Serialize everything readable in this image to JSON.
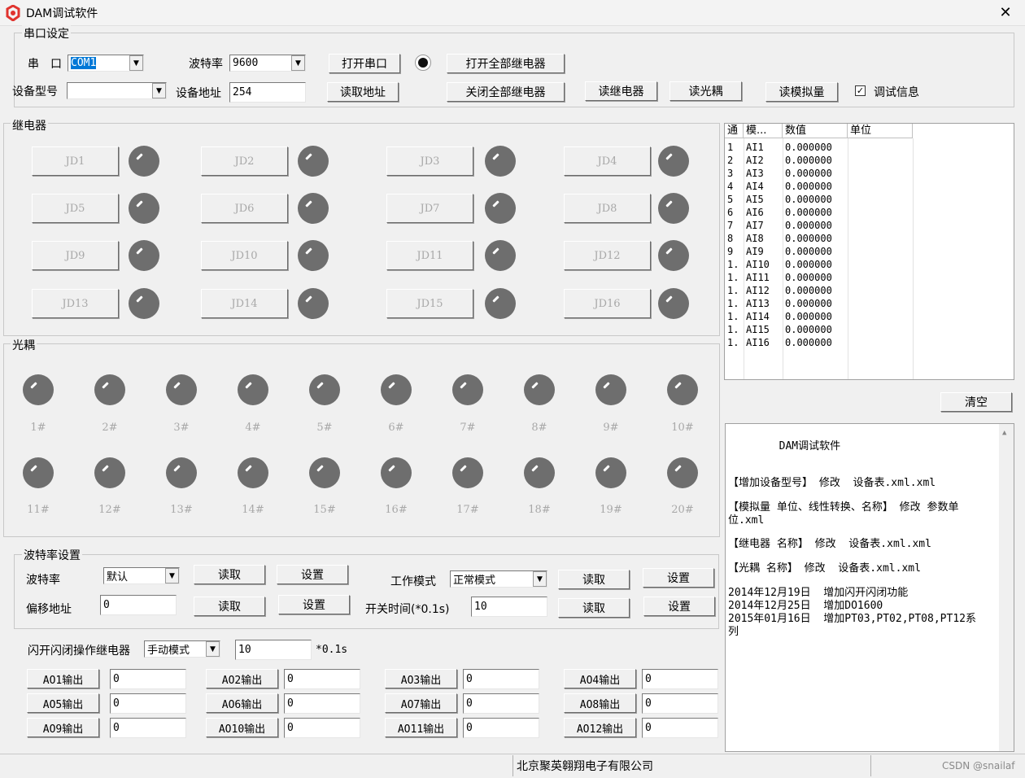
{
  "window": {
    "title": "DAM调试软件",
    "close_glyph": "✕"
  },
  "serial": {
    "group_label": "串口设定",
    "port_label": "串　口",
    "port_value": "COM1",
    "baud_label": "波特率",
    "baud_value": "9600",
    "open_port": "打开串口",
    "open_all_relays": "打开全部继电器",
    "device_model_label": "设备型号",
    "device_model_value": "",
    "device_addr_label": "设备地址",
    "device_addr_value": "254",
    "read_addr": "读取地址",
    "close_all_relays": "关闭全部继电器",
    "read_relay": "读继电器",
    "read_optocoupler": "读光耦",
    "read_analog": "读模拟量",
    "debug_info_label": "调试信息",
    "debug_info_checked": true
  },
  "relays": {
    "group_label": "继电器",
    "items": [
      "JD1",
      "JD2",
      "JD3",
      "JD4",
      "JD5",
      "JD6",
      "JD7",
      "JD8",
      "JD9",
      "JD10",
      "JD11",
      "JD12",
      "JD13",
      "JD14",
      "JD15",
      "JD16"
    ]
  },
  "optocouplers": {
    "group_label": "光耦",
    "items": [
      "1#",
      "2#",
      "3#",
      "4#",
      "5#",
      "6#",
      "7#",
      "8#",
      "9#",
      "10#",
      "11#",
      "12#",
      "13#",
      "14#",
      "15#",
      "16#",
      "17#",
      "18#",
      "19#",
      "20#"
    ]
  },
  "analog_table": {
    "headers": [
      "通",
      "模...",
      "数值",
      "单位"
    ],
    "rows": [
      [
        "1",
        "AI1",
        "0.000000",
        ""
      ],
      [
        "2",
        "AI2",
        "0.000000",
        ""
      ],
      [
        "3",
        "AI3",
        "0.000000",
        ""
      ],
      [
        "4",
        "AI4",
        "0.000000",
        ""
      ],
      [
        "5",
        "AI5",
        "0.000000",
        ""
      ],
      [
        "6",
        "AI6",
        "0.000000",
        ""
      ],
      [
        "7",
        "AI7",
        "0.000000",
        ""
      ],
      [
        "8",
        "AI8",
        "0.000000",
        ""
      ],
      [
        "9",
        "AI9",
        "0.000000",
        ""
      ],
      [
        "1.",
        "AI10",
        "0.000000",
        ""
      ],
      [
        "1.",
        "AI11",
        "0.000000",
        ""
      ],
      [
        "1.",
        "AI12",
        "0.000000",
        ""
      ],
      [
        "1.",
        "AI13",
        "0.000000",
        ""
      ],
      [
        "1.",
        "AI14",
        "0.000000",
        ""
      ],
      [
        "1.",
        "AI15",
        "0.000000",
        ""
      ],
      [
        "1.",
        "AI16",
        "0.000000",
        ""
      ]
    ]
  },
  "clear_button": "清空",
  "info_memo": {
    "lines": [
      "        DAM调试软件",
      "【增加设备型号】 修改  设备表.xml.xml",
      "【模拟量 单位、线性转换、名称】 修改 参数单",
      "位.xml",
      "【继电器 名称】 修改  设备表.xml.xml",
      "【光耦 名称】 修改  设备表.xml.xml",
      "2014年12月19日  增加闪开闪闭功能",
      "2014年12月25日  增加DO1600",
      "2015年01月16日  增加PT03,PT02,PT08,PT12系",
      "列"
    ]
  },
  "baud_settings": {
    "group_label": "波特率设置",
    "baud_label": "波特率",
    "baud_value": "默认",
    "read1": "读取",
    "set1": "设置",
    "work_mode_label": "工作模式",
    "work_mode_value": "正常模式",
    "read2": "读取",
    "set2": "设置",
    "offset_label": "偏移地址",
    "offset_value": "0",
    "read3": "读取",
    "set3": "设置",
    "switch_time_label": "开关时间(*0.1s)",
    "switch_time_value": "10",
    "read4": "读取",
    "set4": "设置"
  },
  "flash": {
    "label": "闪开闪闭操作继电器",
    "mode_value": "手动模式",
    "time_value": "10",
    "unit": "*0.1s"
  },
  "ao_outputs": [
    {
      "label": "AO1输出",
      "value": "0"
    },
    {
      "label": "AO2输出",
      "value": "0"
    },
    {
      "label": "AO3输出",
      "value": "0"
    },
    {
      "label": "AO4输出",
      "value": "0"
    },
    {
      "label": "AO5输出",
      "value": "0"
    },
    {
      "label": "AO6输出",
      "value": "0"
    },
    {
      "label": "AO7输出",
      "value": "0"
    },
    {
      "label": "AO8输出",
      "value": "0"
    },
    {
      "label": "AO9输出",
      "value": "0"
    },
    {
      "label": "AO10输出",
      "value": "0"
    },
    {
      "label": "AO11输出",
      "value": "0"
    },
    {
      "label": "AO12输出",
      "value": "0"
    }
  ],
  "status": {
    "company": "北京聚英翱翔电子有限公司",
    "watermark": "CSDN @snailaf"
  },
  "colors": {
    "led_off": "#6e6e6e",
    "selection": "#0078d7",
    "app_icon": "#e0332e"
  }
}
